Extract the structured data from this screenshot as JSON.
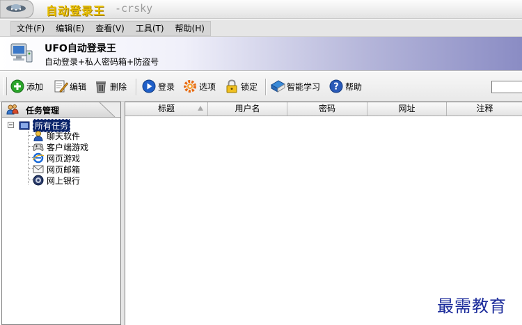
{
  "window": {
    "title": "自动登录王",
    "subtitle": "-crsky"
  },
  "menu": [
    "文件(F)",
    "编辑(E)",
    "查看(V)",
    "工具(T)",
    "帮助(H)"
  ],
  "banner": {
    "title": "UFO自动登录王",
    "subtitle": "自动登录+私人密码箱+防盗号"
  },
  "toolbar": {
    "add": "添加",
    "edit": "编辑",
    "delete": "删除",
    "login": "登录",
    "options": "选项",
    "lock": "锁定",
    "learn": "智能学习",
    "help": "帮助",
    "search_value": ""
  },
  "left_panel": {
    "header": "任务管理",
    "root": "所有任务",
    "items": [
      "聊天软件",
      "客户端游戏",
      "网页游戏",
      "网页邮箱",
      "网上银行"
    ]
  },
  "table": {
    "columns": [
      "标题",
      "用户名",
      "密码",
      "网址",
      "注释"
    ]
  },
  "watermark": "最需教育",
  "colors": {
    "title_gold": "#e8c000",
    "selection": "#0a246a",
    "banner_end": "#8a8cc4",
    "watermark": "#1a2a9a"
  }
}
